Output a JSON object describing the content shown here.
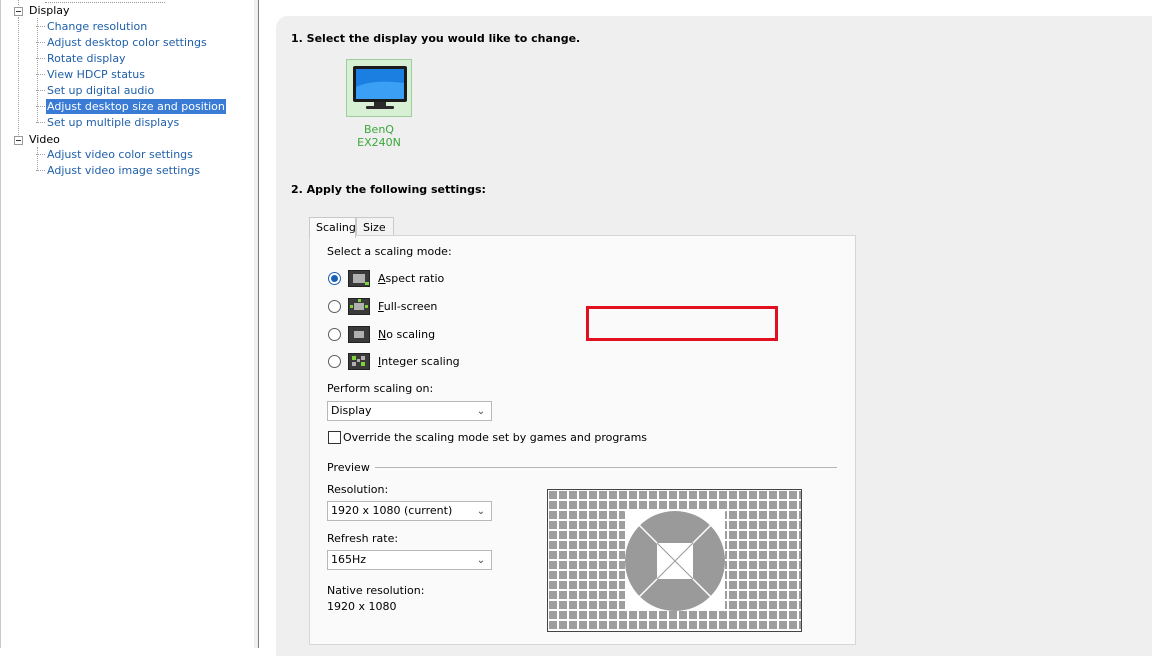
{
  "tree": {
    "groups": [
      {
        "label": "Display",
        "items": [
          {
            "label": "Change resolution",
            "selected": false
          },
          {
            "label": "Adjust desktop color settings",
            "selected": false
          },
          {
            "label": "Rotate display",
            "selected": false
          },
          {
            "label": "View HDCP status",
            "selected": false
          },
          {
            "label": "Set up digital audio",
            "selected": false
          },
          {
            "label": "Adjust desktop size and position",
            "selected": true
          },
          {
            "label": "Set up multiple displays",
            "selected": false
          }
        ]
      },
      {
        "label": "Video",
        "items": [
          {
            "label": "Adjust video color settings",
            "selected": false
          },
          {
            "label": "Adjust video image settings",
            "selected": false
          }
        ]
      }
    ]
  },
  "step1": {
    "title": "1. Select the display you would like to change.",
    "display_name": "BenQ EX240N"
  },
  "step2": {
    "title": "2. Apply the following settings:",
    "tabs": [
      "Scaling",
      "Size"
    ],
    "active_tab": "Scaling",
    "scaling_mode_label": "Select a scaling mode:",
    "modes": [
      {
        "label_pre": "",
        "accel": "A",
        "label_post": "spect ratio",
        "checked": true,
        "icon": "aspect-ratio-icon"
      },
      {
        "label_pre": "",
        "accel": "F",
        "label_post": "ull-screen",
        "checked": false,
        "icon": "full-screen-icon"
      },
      {
        "label_pre": "",
        "accel": "N",
        "label_post": "o scaling",
        "checked": false,
        "icon": "no-scaling-icon"
      },
      {
        "label_pre": "",
        "accel": "I",
        "label_post": "nteger scaling",
        "checked": false,
        "icon": "integer-scaling-icon"
      }
    ],
    "perform_on_label": "Perform scaling on:",
    "perform_on_value": "Display",
    "override_label": "Override the scaling mode set by games and programs",
    "override_checked": false,
    "preview_label": "Preview",
    "resolution_label": "Resolution:",
    "resolution_value": "1920 x 1080 (current)",
    "refresh_label": "Refresh rate:",
    "refresh_value": "165Hz",
    "native_label": "Native resolution:",
    "native_value": "1920 x 1080"
  },
  "colors": {
    "selection": "#3a7bd5",
    "link": "#1f5fa8",
    "display_name": "#3aa83a",
    "highlight_box": "#e01020",
    "radio_accent": "#1a5fb4"
  }
}
